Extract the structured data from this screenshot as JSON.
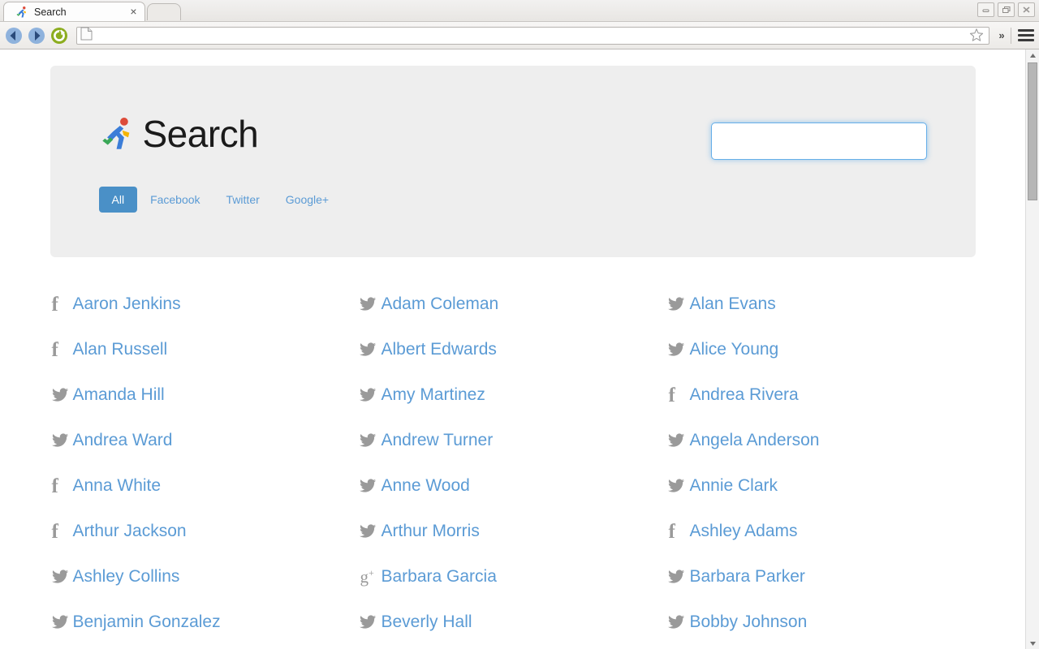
{
  "browser": {
    "tab": {
      "title": "Search",
      "favicon": "runner-icon",
      "close_label": "×"
    },
    "new_tab_label": "",
    "window_controls": {
      "minimize": "minimize-icon",
      "maximize": "restore-icon",
      "close": "close-icon"
    },
    "toolbar": {
      "back": "back-arrow-icon",
      "forward": "forward-arrow-icon",
      "reload": "reload-icon",
      "page_icon": "page-document-icon",
      "url_value": "",
      "url_placeholder": "",
      "bookmark": "star-icon",
      "overflow": "»",
      "menu": "hamburger-menu-icon"
    }
  },
  "page": {
    "header": {
      "logo": "runner-logo",
      "title": "Search",
      "filters": [
        {
          "label": "All",
          "active": true
        },
        {
          "label": "Facebook",
          "active": false
        },
        {
          "label": "Twitter",
          "active": false
        },
        {
          "label": "Google+",
          "active": false
        }
      ],
      "search": {
        "value": "",
        "placeholder": ""
      }
    },
    "results": [
      {
        "network": "facebook",
        "name": "Aaron Jenkins"
      },
      {
        "network": "twitter",
        "name": "Adam Coleman"
      },
      {
        "network": "twitter",
        "name": "Alan Evans"
      },
      {
        "network": "facebook",
        "name": "Alan Russell"
      },
      {
        "network": "twitter",
        "name": "Albert Edwards"
      },
      {
        "network": "twitter",
        "name": "Alice Young"
      },
      {
        "network": "twitter",
        "name": "Amanda Hill"
      },
      {
        "network": "twitter",
        "name": "Amy Martinez"
      },
      {
        "network": "facebook",
        "name": "Andrea Rivera"
      },
      {
        "network": "twitter",
        "name": "Andrea Ward"
      },
      {
        "network": "twitter",
        "name": "Andrew Turner"
      },
      {
        "network": "twitter",
        "name": "Angela Anderson"
      },
      {
        "network": "facebook",
        "name": "Anna White"
      },
      {
        "network": "twitter",
        "name": "Anne Wood"
      },
      {
        "network": "twitter",
        "name": "Annie Clark"
      },
      {
        "network": "facebook",
        "name": "Arthur Jackson"
      },
      {
        "network": "twitter",
        "name": "Arthur Morris"
      },
      {
        "network": "facebook",
        "name": "Ashley Adams"
      },
      {
        "network": "twitter",
        "name": "Ashley Collins"
      },
      {
        "network": "googleplus",
        "name": "Barbara Garcia"
      },
      {
        "network": "twitter",
        "name": "Barbara Parker"
      },
      {
        "network": "twitter",
        "name": "Benjamin Gonzalez"
      },
      {
        "network": "twitter",
        "name": "Beverly Hall"
      },
      {
        "network": "twitter",
        "name": "Bobby Johnson"
      }
    ]
  },
  "colors": {
    "accent_blue": "#4a90c7",
    "link_blue": "#5b9bd5",
    "jumbotron_bg": "#eeeeee",
    "icon_gray": "#9a9a9a",
    "focus_border": "#66afe9"
  }
}
